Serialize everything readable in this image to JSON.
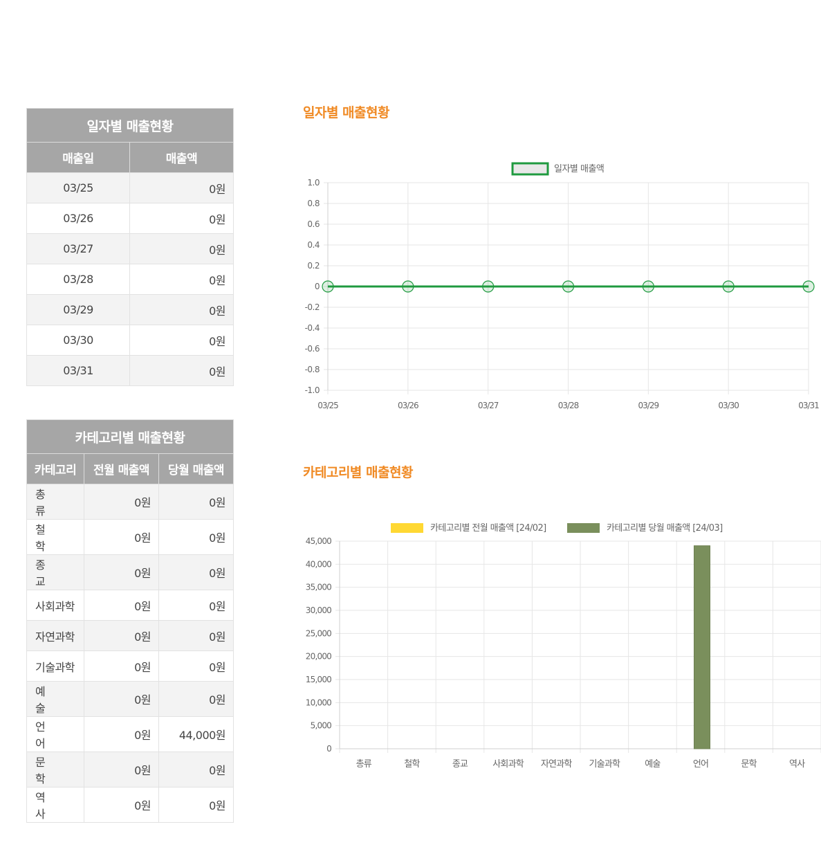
{
  "daily_table": {
    "caption": "일자별 매출현황",
    "headers": [
      "매출일",
      "매출액"
    ],
    "rows": [
      {
        "date": "03/25",
        "amount": "0원"
      },
      {
        "date": "03/26",
        "amount": "0원"
      },
      {
        "date": "03/27",
        "amount": "0원"
      },
      {
        "date": "03/28",
        "amount": "0원"
      },
      {
        "date": "03/29",
        "amount": "0원"
      },
      {
        "date": "03/30",
        "amount": "0원"
      },
      {
        "date": "03/31",
        "amount": "0원"
      }
    ]
  },
  "category_table": {
    "caption": "카테고리별 매출현황",
    "headers": [
      "카테고리",
      "전월 매출액",
      "당월 매출액"
    ],
    "rows": [
      {
        "category": "총류",
        "prev": "0원",
        "curr": "0원"
      },
      {
        "category": "철학",
        "prev": "0원",
        "curr": "0원"
      },
      {
        "category": "종교",
        "prev": "0원",
        "curr": "0원"
      },
      {
        "category": "사회과학",
        "prev": "0원",
        "curr": "0원"
      },
      {
        "category": "자연과학",
        "prev": "0원",
        "curr": "0원"
      },
      {
        "category": "기술과학",
        "prev": "0원",
        "curr": "0원"
      },
      {
        "category": "예술",
        "prev": "0원",
        "curr": "0원"
      },
      {
        "category": "언어",
        "prev": "0원",
        "curr": "44,000원"
      },
      {
        "category": "문학",
        "prev": "0원",
        "curr": "0원"
      },
      {
        "category": "역사",
        "prev": "0원",
        "curr": "0원"
      }
    ]
  },
  "daily_chart_title": "일자별 매출현황",
  "category_chart_title": "카테고리별 매출현황",
  "colors": {
    "accent_orange": "#f08a24",
    "line_green": "#1f9a3f",
    "prev_yellow": "#ffd833",
    "curr_olive": "#7a8f5c",
    "header_gray": "#a6a6a6"
  },
  "chart_data": [
    {
      "type": "line",
      "categories": [
        "03/25",
        "03/26",
        "03/27",
        "03/28",
        "03/29",
        "03/30",
        "03/31"
      ],
      "series": [
        {
          "name": "일자별 매출액",
          "values": [
            0,
            0,
            0,
            0,
            0,
            0,
            0
          ]
        }
      ],
      "ylim": [
        -1.0,
        1.0
      ],
      "yticks": [
        "1.0",
        "0.8",
        "0.6",
        "0.4",
        "0.2",
        "0",
        "-0.2",
        "-0.4",
        "-0.6",
        "-0.8",
        "-1.0"
      ],
      "grid": true,
      "legend": "top-center"
    },
    {
      "type": "bar",
      "categories": [
        "총류",
        "철학",
        "종교",
        "사회과학",
        "자연과학",
        "기술과학",
        "예술",
        "언어",
        "문학",
        "역사"
      ],
      "series": [
        {
          "name": "카테고리별 전월 매출액 [24/02]",
          "values": [
            0,
            0,
            0,
            0,
            0,
            0,
            0,
            0,
            0,
            0
          ]
        },
        {
          "name": "카테고리별 당월 매출액 [24/03]",
          "values": [
            0,
            0,
            0,
            0,
            0,
            0,
            0,
            44000,
            0,
            0
          ]
        }
      ],
      "ylim": [
        0,
        45000
      ],
      "yticks": [
        "45,000",
        "40,000",
        "35,000",
        "30,000",
        "25,000",
        "20,000",
        "15,000",
        "10,000",
        "5,000",
        "0"
      ],
      "grid": true,
      "legend": "top-center"
    }
  ]
}
